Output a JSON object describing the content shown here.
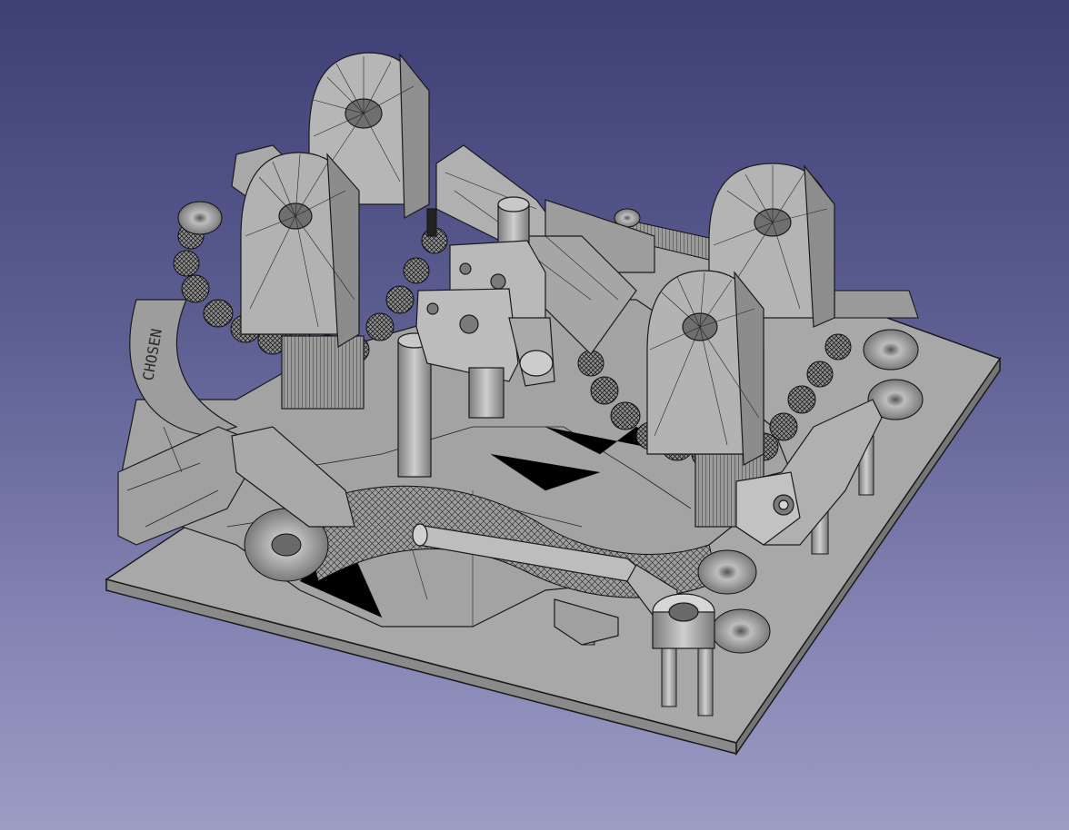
{
  "viewport": {
    "background_top": "#3e3f75",
    "background_bottom": "#9c9cc4",
    "model_gray": "#a6a6a6",
    "edge_color": "#1a1a1a"
  },
  "model": {
    "engraved_text": "CHOSEN"
  }
}
